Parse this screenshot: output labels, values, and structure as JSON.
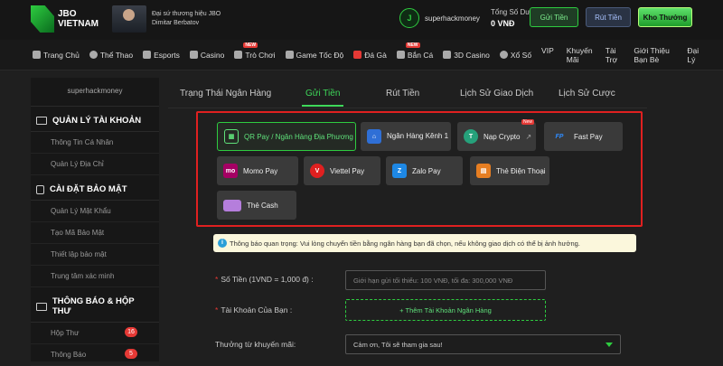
{
  "brand": {
    "logo_line1": "JBO",
    "logo_line2": "VIETNAM"
  },
  "ambassador": {
    "line1": "Đại sứ thương hiệu JBO",
    "line2": "Dimitar Berbatov"
  },
  "user": {
    "name": "superhackmoney",
    "balance_label": "Tổng Số Dư",
    "balance_value": "0 VNĐ"
  },
  "header_buttons": {
    "deposit": "Gửi Tiền",
    "withdraw": "Rút Tiền",
    "reward": "Kho Thưởng"
  },
  "nav": {
    "items": [
      {
        "label": "Trang Chủ",
        "icon": "home-icon"
      },
      {
        "label": "Thể Thao",
        "icon": "soccer-ball-icon"
      },
      {
        "label": "Esports",
        "icon": "gamepad-icon"
      },
      {
        "label": "Casino",
        "icon": "casino-icon"
      },
      {
        "label": "Trò Chơi",
        "icon": "slots-icon",
        "badge": "NEW"
      },
      {
        "label": "Game Tốc Độ",
        "icon": "speed-icon"
      },
      {
        "label": "Đá Gà",
        "icon": "rooster-icon"
      },
      {
        "label": "Bắn Cá",
        "icon": "fish-icon",
        "badge": "NEW"
      },
      {
        "label": "3D Casino",
        "icon": "cube-icon"
      },
      {
        "label": "Xổ Số",
        "icon": "lottery-icon"
      }
    ],
    "right": [
      "VIP",
      "Khuyến Mãi",
      "Tài Trợ",
      "Giới Thiệu Bạn Bè",
      "Đại Lý"
    ]
  },
  "sidebar": {
    "username": "superhackmoney",
    "sections": [
      {
        "title": "QUẢN LÝ TÀI KHOẢN",
        "items": [
          "Thông Tin Cá Nhân",
          "Quản Lý Địa Chỉ"
        ]
      },
      {
        "title": "CÀI ĐẶT BẢO MẬT",
        "items": [
          "Quản Lý Mật Khẩu",
          "Tạo Mã Bảo Mật",
          "Thiết lập bảo mật",
          "Trung tâm xác minh"
        ]
      },
      {
        "title": "THÔNG BÁO & HỘP THƯ",
        "items": [
          "Hộp Thư",
          "Thông Báo"
        ],
        "counts": [
          "16",
          "5"
        ]
      }
    ]
  },
  "tabs": [
    "Trạng Thái Ngân Hàng",
    "Gửi Tiền",
    "Rút Tiền",
    "Lịch Sử Giao Dịch",
    "Lịch Sử Cược"
  ],
  "active_tab": "Gửi Tiền",
  "payment_methods": [
    {
      "label": "QR Pay / Ngân Hàng Địa Phương",
      "icon": "qr-code-icon",
      "active": true
    },
    {
      "label": "Ngân Hàng Kênh 1",
      "icon": "bank-icon"
    },
    {
      "label": "Nạp Crypto",
      "icon": "tether-icon",
      "badge": "New"
    },
    {
      "label": "Fast Pay",
      "icon": "fastpay-icon"
    },
    {
      "label": "Momo Pay",
      "icon": "momo-icon"
    },
    {
      "label": "Viettel Pay",
      "icon": "viettel-icon"
    },
    {
      "label": "Zalo Pay",
      "icon": "zalopay-icon"
    },
    {
      "label": "Thẻ Điện Thoại",
      "icon": "phone-card-icon"
    },
    {
      "label": "Thẻ Cash",
      "icon": "cash-card-icon"
    }
  ],
  "notice": "Thông báo quan trọng: Vui lòng chuyển tiền bằng ngân hàng bạn đã chọn, nếu không giao dịch có thể bị ảnh hưởng.",
  "form": {
    "amount_label": "Số Tiền (1VND = 1,000 đ) :",
    "amount_placeholder": "Giới hạn gửi tối thiểu: 100 VNĐ, tối đa: 300,000 VNĐ",
    "account_label": "Tài Khoản Của Bạn :",
    "add_bank_label": "+ Thêm Tài Khoản Ngân Hàng",
    "promo_label": "Thưởng từ khuyến mãi:",
    "promo_selected": "Cảm ơn, Tôi sẽ tham gia sau!"
  },
  "colors": {
    "accent": "#2ecc40",
    "highlight_border": "#e02020",
    "badge": "#e53935"
  }
}
